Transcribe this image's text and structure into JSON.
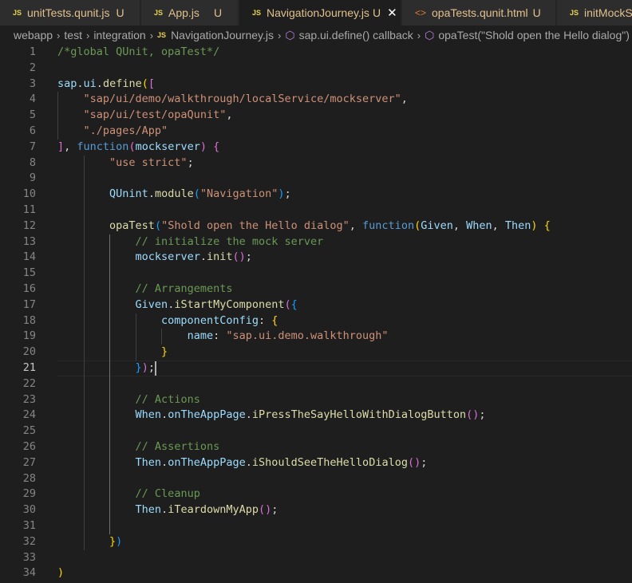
{
  "tabs": [
    {
      "icon": "JS",
      "name": "unitTests.qunit.js",
      "status": "U",
      "active": false
    },
    {
      "icon": "JS",
      "name": "App.js",
      "status": "U",
      "active": false
    },
    {
      "icon": "JS",
      "name": "NavigationJourney.js",
      "status": "U",
      "active": true,
      "close": "✕"
    },
    {
      "icon": "<>",
      "name": "opaTests.qunit.html",
      "status": "U",
      "active": false
    },
    {
      "icon": "JS",
      "name": "initMockServer.js",
      "status": "",
      "active": false
    }
  ],
  "breadcrumb": {
    "items": [
      "webapp",
      "test",
      "integration",
      "NavigationJourney.js",
      "sap.ui.define() callback",
      "opaTest(\"Shold open the Hello dialog\")"
    ],
    "file_icon": "JS",
    "separator": "›"
  },
  "editor": {
    "current_line": 21,
    "lines": [
      [
        [
          "cm",
          "/*global QUnit, opaTest*/"
        ]
      ],
      [],
      [
        [
          "var",
          "sap"
        ],
        [
          "pl",
          "."
        ],
        [
          "var",
          "ui"
        ],
        [
          "pl",
          "."
        ],
        [
          "fn",
          "define"
        ],
        [
          "br1",
          "("
        ],
        [
          "br2",
          "["
        ]
      ],
      [
        [
          "pl",
          "    "
        ],
        [
          "str",
          "\"sap/ui/demo/walkthrough/localService/mockserver\""
        ],
        [
          "pl",
          ","
        ]
      ],
      [
        [
          "pl",
          "    "
        ],
        [
          "str",
          "\"sap/ui/test/opaQunit\""
        ],
        [
          "pl",
          ","
        ]
      ],
      [
        [
          "pl",
          "    "
        ],
        [
          "str",
          "\"./pages/App\""
        ]
      ],
      [
        [
          "br2",
          "]"
        ],
        [
          "pl",
          ", "
        ],
        [
          "kw",
          "function"
        ],
        [
          "br2",
          "("
        ],
        [
          "var",
          "mockserver"
        ],
        [
          "br2",
          ")"
        ],
        [
          "pl",
          " "
        ],
        [
          "br2",
          "{"
        ]
      ],
      [
        [
          "pl",
          "        "
        ],
        [
          "str",
          "\"use strict\""
        ],
        [
          "pl",
          ";"
        ]
      ],
      [],
      [
        [
          "pl",
          "        "
        ],
        [
          "var",
          "QUnint"
        ],
        [
          "pl",
          "."
        ],
        [
          "fn",
          "module"
        ],
        [
          "br3",
          "("
        ],
        [
          "str",
          "\"Navigation\""
        ],
        [
          "br3",
          ")"
        ],
        [
          "pl",
          ";"
        ]
      ],
      [],
      [
        [
          "pl",
          "        "
        ],
        [
          "fn",
          "opaTest"
        ],
        [
          "br3",
          "("
        ],
        [
          "str",
          "\"Shold open the Hello dialog\""
        ],
        [
          "pl",
          ", "
        ],
        [
          "kw",
          "function"
        ],
        [
          "br1",
          "("
        ],
        [
          "var",
          "Given"
        ],
        [
          "pl",
          ", "
        ],
        [
          "var",
          "When"
        ],
        [
          "pl",
          ", "
        ],
        [
          "var",
          "Then"
        ],
        [
          "br1",
          ")"
        ],
        [
          "pl",
          " "
        ],
        [
          "br1",
          "{"
        ]
      ],
      [
        [
          "pl",
          "            "
        ],
        [
          "cm",
          "// initialize the mock server"
        ]
      ],
      [
        [
          "pl",
          "            "
        ],
        [
          "var",
          "mockserver"
        ],
        [
          "pl",
          "."
        ],
        [
          "fn",
          "init"
        ],
        [
          "br2",
          "()"
        ],
        [
          "pl",
          ";"
        ]
      ],
      [],
      [
        [
          "pl",
          "            "
        ],
        [
          "cm",
          "// Arrangements"
        ]
      ],
      [
        [
          "pl",
          "            "
        ],
        [
          "var",
          "Given"
        ],
        [
          "pl",
          "."
        ],
        [
          "fn",
          "iStartMyComponent"
        ],
        [
          "br2",
          "("
        ],
        [
          "br3",
          "{"
        ]
      ],
      [
        [
          "pl",
          "                "
        ],
        [
          "var",
          "componentConfig"
        ],
        [
          "pl",
          ": "
        ],
        [
          "br1",
          "{"
        ]
      ],
      [
        [
          "pl",
          "                    "
        ],
        [
          "var",
          "name"
        ],
        [
          "pl",
          ": "
        ],
        [
          "str",
          "\"sap.ui.demo.walkthrough\""
        ]
      ],
      [
        [
          "pl",
          "                "
        ],
        [
          "br1",
          "}"
        ]
      ],
      [
        [
          "pl",
          "            "
        ],
        [
          "br3",
          "}"
        ],
        [
          "br2",
          ")"
        ],
        [
          "pl",
          ";"
        ]
      ],
      [],
      [
        [
          "pl",
          "            "
        ],
        [
          "cm",
          "// Actions"
        ]
      ],
      [
        [
          "pl",
          "            "
        ],
        [
          "var",
          "When"
        ],
        [
          "pl",
          "."
        ],
        [
          "var",
          "onTheAppPage"
        ],
        [
          "pl",
          "."
        ],
        [
          "fn",
          "iPressTheSayHelloWithDialogButton"
        ],
        [
          "br2",
          "()"
        ],
        [
          "pl",
          ";"
        ]
      ],
      [],
      [
        [
          "pl",
          "            "
        ],
        [
          "cm",
          "// Assertions"
        ]
      ],
      [
        [
          "pl",
          "            "
        ],
        [
          "var",
          "Then"
        ],
        [
          "pl",
          "."
        ],
        [
          "var",
          "onTheAppPage"
        ],
        [
          "pl",
          "."
        ],
        [
          "fn",
          "iShouldSeeTheHelloDialog"
        ],
        [
          "br2",
          "()"
        ],
        [
          "pl",
          ";"
        ]
      ],
      [],
      [
        [
          "pl",
          "            "
        ],
        [
          "cm",
          "// Cleanup"
        ]
      ],
      [
        [
          "pl",
          "            "
        ],
        [
          "var",
          "Then"
        ],
        [
          "pl",
          "."
        ],
        [
          "fn",
          "iTeardownMyApp"
        ],
        [
          "br2",
          "()"
        ],
        [
          "pl",
          ";"
        ]
      ],
      [],
      [
        [
          "pl",
          "        "
        ],
        [
          "br1",
          "}"
        ],
        [
          "br3",
          ")"
        ]
      ],
      [],
      [
        [
          "br1",
          ")"
        ]
      ]
    ]
  },
  "colors": {
    "background": "#1e1e1e",
    "comment": "#6a9955",
    "string": "#ce9178",
    "keyword": "#569cd6",
    "variable": "#9cdcfe",
    "function": "#dcdcaa"
  }
}
